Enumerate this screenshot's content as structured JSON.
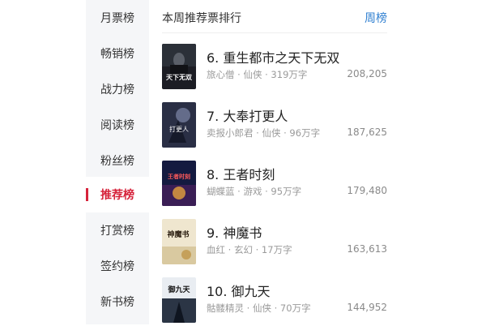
{
  "sidebar": {
    "items": [
      {
        "label": "月票榜",
        "active": false
      },
      {
        "label": "畅销榜",
        "active": false
      },
      {
        "label": "战力榜",
        "active": false
      },
      {
        "label": "阅读榜",
        "active": false
      },
      {
        "label": "粉丝榜",
        "active": false
      },
      {
        "label": "推荐榜",
        "active": true
      },
      {
        "label": "打赏榜",
        "active": false
      },
      {
        "label": "签约榜",
        "active": false
      },
      {
        "label": "新书榜",
        "active": false
      }
    ]
  },
  "header": {
    "title": "本周推荐票排行",
    "period_link": "周榜"
  },
  "books": [
    {
      "title": "6. 重生都市之天下无双",
      "meta": "旅心僧 · 仙侠 · 319万字",
      "votes": "208,205",
      "cover_text": "天下无双",
      "cover_icon": "book-cover-6"
    },
    {
      "title": "7. 大奉打更人",
      "meta": "卖报小郎君 · 仙侠 · 96万字",
      "votes": "187,625",
      "cover_text": "打更人",
      "cover_icon": "book-cover-7"
    },
    {
      "title": "8. 王者时刻",
      "meta": "蝴蝶蓝 · 游戏 · 95万字",
      "votes": "179,480",
      "cover_text": "王者时刻",
      "cover_icon": "book-cover-8"
    },
    {
      "title": "9. 神魔书",
      "meta": "血红 · 玄幻 · 17万字",
      "votes": "163,613",
      "cover_text": "神魔书",
      "cover_icon": "book-cover-9"
    },
    {
      "title": "10. 御九天",
      "meta": "骷髅精灵 · 仙侠 · 70万字",
      "votes": "144,952",
      "cover_text": "御九天",
      "cover_icon": "book-cover-10"
    }
  ],
  "colors": {
    "accent": "#d6233b",
    "link": "#2f7fd0",
    "sidebar_bg": "#f5f6f8"
  }
}
